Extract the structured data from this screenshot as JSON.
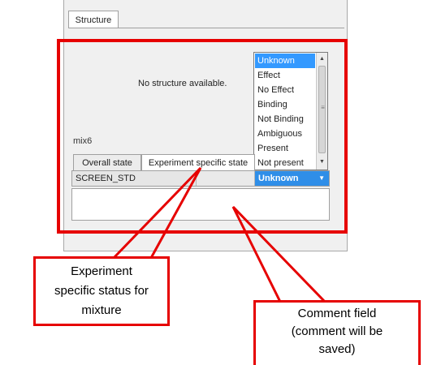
{
  "tabs": {
    "structure": "Structure",
    "overall_state": "Overall state",
    "experiment_specific_state": "Experiment specific state"
  },
  "structure_message": "No structure available.",
  "mixture_label": "mix6",
  "dropdown": {
    "options": [
      "Unknown",
      "Effect",
      "No Effect",
      "Binding",
      "Not Binding",
      "Ambiguous",
      "Present",
      "Not present"
    ],
    "selected_index": 0
  },
  "status_row": {
    "screen_name": "SCREEN_STD",
    "selected_value": "Unknown"
  },
  "comment_value": "",
  "annotations": {
    "left": "Experiment\nspecific status for\nmixture",
    "right": "Comment field\n(comment will be\nsaved)"
  },
  "colors": {
    "annotation_red": "#e60000",
    "selection_blue": "#3399ff"
  }
}
